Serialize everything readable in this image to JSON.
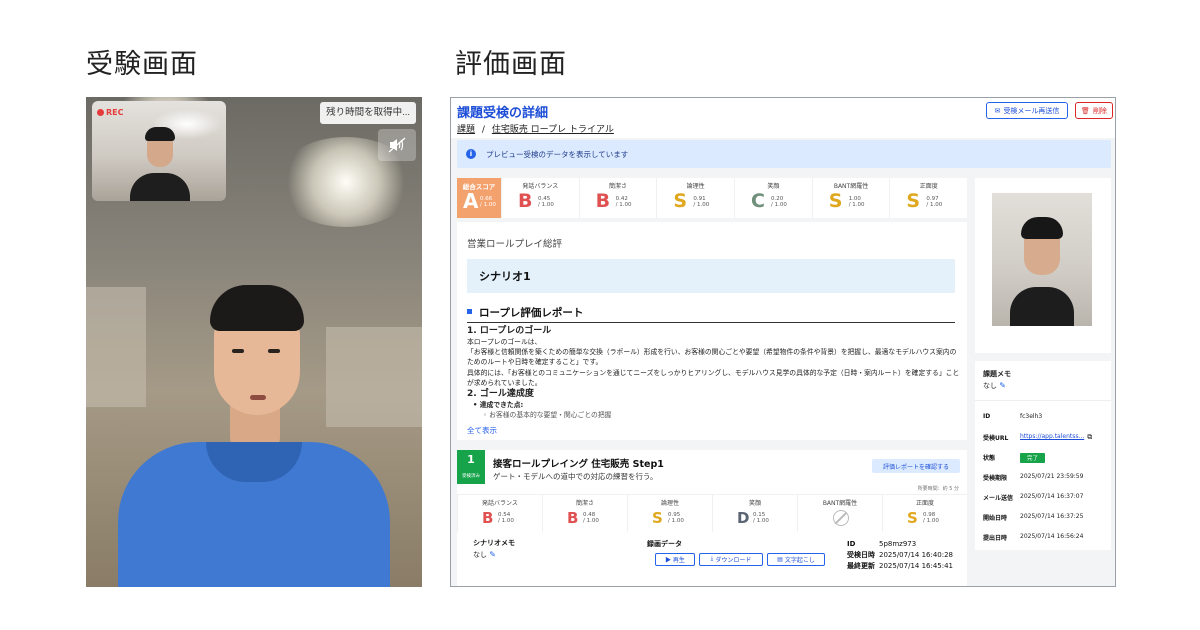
{
  "headings": {
    "left": "受験画面",
    "right": "評価画面"
  },
  "exam": {
    "rec_label": "REC",
    "time_button": "残り時間を取得中...",
    "mute_icon": "speaker-muted-icon"
  },
  "evaluation": {
    "title": "課題受検の詳細",
    "breadcrumb": {
      "root": "課題",
      "separator": "/",
      "current": "住宅販売 ロープレ トライアル"
    },
    "resend_button": "受検メール再送信",
    "delete_button": "削除",
    "notice": "プレビュー受検のデータを表示しています",
    "total_score": {
      "label": "総合スコア",
      "grade": "A",
      "value": "0.66",
      "max": "/ 1.00"
    },
    "scores": [
      {
        "label": "発話バランス",
        "grade": "B",
        "value": "0.45",
        "max": "/ 1.00",
        "color": "#e05252"
      },
      {
        "label": "簡潔さ",
        "grade": "B",
        "value": "0.42",
        "max": "/ 1.00",
        "color": "#e05252"
      },
      {
        "label": "論理性",
        "grade": "S",
        "value": "0.91",
        "max": "/ 1.00",
        "color": "#e0a81f"
      },
      {
        "label": "笑顔",
        "grade": "C",
        "value": "0.20",
        "max": "/ 1.00",
        "color": "#6f8f7a"
      },
      {
        "label": "BANT網羅性",
        "grade": "S",
        "value": "1.00",
        "max": "/ 1.00",
        "color": "#e0a81f"
      },
      {
        "label": "正面度",
        "grade": "S",
        "value": "0.97",
        "max": "/ 1.00",
        "color": "#e0a81f"
      }
    ],
    "summary": {
      "title": "営業ロールプレイ総評",
      "scenario": "シナリオ1",
      "report_title": "ロープレ評価レポート",
      "section1_title": "1. ロープレのゴール",
      "para1": "本ロープレのゴールは、",
      "para2": "「お客様と信頼関係を築くための簡単な交換（ラポール）形成を行い、お客様の関心ごとや要望（希望物件の条件や背景）を把握し、最適なモデルハウス案内のためのルートや日時を確定すること」です。",
      "para3": "具体的には、「お客様とのコミュニケーションを通じてニーズをしっかりヒアリングし、モデルハウス見学の具体的な予定（日時・案内ルート）を確定する」ことが求められていました。",
      "section2_title": "2. ゴール達成度",
      "achieved_label": "• 達成できた点:",
      "achieved_item": "◦ お客様の基本的な要望・関心ごとの把握",
      "show_all": "全て表示"
    },
    "step": {
      "number": "1",
      "status": "受検済み",
      "title": "接客ロールプレイング 住宅販売 Step1",
      "description": "ゲート・モデルへの道中での対応の練習を行う。",
      "eval_report_button": "評価レポートを確認する",
      "time": "所要時間：約 5 分",
      "scores": [
        {
          "label": "発話バランス",
          "grade": "B",
          "value": "0.54",
          "max": "/ 1.00",
          "color": "#e05252"
        },
        {
          "label": "簡潔さ",
          "grade": "B",
          "value": "0.48",
          "max": "/ 1.00",
          "color": "#e05252"
        },
        {
          "label": "論理性",
          "grade": "S",
          "value": "0.95",
          "max": "/ 1.00",
          "color": "#e0a81f"
        },
        {
          "label": "笑顔",
          "grade": "D",
          "value": "0.15",
          "max": "/ 1.00",
          "color": "#5b6472"
        },
        {
          "label": "BANT網羅性",
          "grade": "",
          "value": "",
          "max": "",
          "color": "#bbbbbb"
        },
        {
          "label": "正面度",
          "grade": "S",
          "value": "0.98",
          "max": "/ 1.00",
          "color": "#e0a81f"
        }
      ],
      "scenario_memo_label": "シナリオメモ",
      "scenario_memo_value": "なし",
      "recording_label": "録画データ",
      "play_button": "▶ 再生",
      "download_button": "ダウンロード",
      "transcribe_button": "文字起こし",
      "meta": [
        {
          "key": "ID",
          "value": "5p8mz973"
        },
        {
          "key": "受検日時",
          "value": "2025/07/14 16:40:28"
        },
        {
          "key": "最終更新",
          "value": "2025/07/14 16:45:41"
        }
      ]
    },
    "side": {
      "memo_label": "課題メモ",
      "memo_value": "なし",
      "info": [
        {
          "key": "ID",
          "value": "fc3elh3"
        },
        {
          "key": "受検URL",
          "value": "https://app.talentss..."
        },
        {
          "key": "状態",
          "value": "完了"
        },
        {
          "key": "受検期限",
          "value": "2025/07/21 23:59:59"
        },
        {
          "key": "メール送信",
          "value": "2025/07/14 16:37:07"
        },
        {
          "key": "開始日時",
          "value": "2025/07/14 16:37:25"
        },
        {
          "key": "提出日時",
          "value": "2025/07/14 16:56:24"
        }
      ]
    }
  }
}
